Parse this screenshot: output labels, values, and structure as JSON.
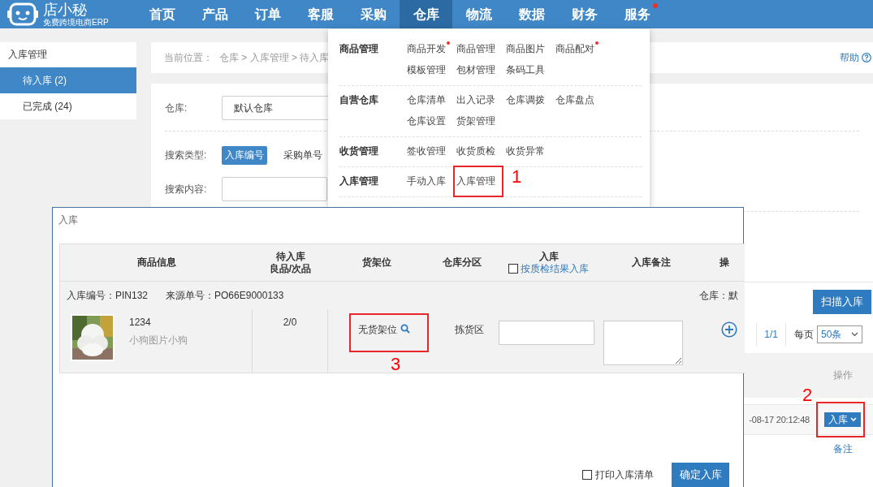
{
  "logo": {
    "name": "店小秘",
    "tagline": "免费跨境电商ERP"
  },
  "nav": [
    {
      "label": "首页",
      "selected": false,
      "dot": false
    },
    {
      "label": "产品",
      "selected": false,
      "dot": false
    },
    {
      "label": "订单",
      "selected": false,
      "dot": false
    },
    {
      "label": "客服",
      "selected": false,
      "dot": false
    },
    {
      "label": "采购",
      "selected": false,
      "dot": false
    },
    {
      "label": "仓库",
      "selected": true,
      "dot": false
    },
    {
      "label": "物流",
      "selected": false,
      "dot": false
    },
    {
      "label": "数据",
      "selected": false,
      "dot": false
    },
    {
      "label": "财务",
      "selected": false,
      "dot": false
    },
    {
      "label": "服务",
      "selected": false,
      "dot": true
    }
  ],
  "menu": {
    "groups": [
      {
        "title": "商品管理",
        "items": [
          {
            "label": "商品开发",
            "dot": true
          },
          {
            "label": "商品管理",
            "dot": false
          },
          {
            "label": "商品图片",
            "dot": false
          },
          {
            "label": "商品配对",
            "dot": true
          },
          {
            "label": "模板管理",
            "dot": false
          },
          {
            "label": "包材管理",
            "dot": false
          },
          {
            "label": "条码工具",
            "dot": false
          }
        ]
      },
      {
        "title": "自营仓库",
        "items": [
          {
            "label": "仓库清单",
            "dot": false
          },
          {
            "label": "出入记录",
            "dot": false
          },
          {
            "label": "仓库调拨",
            "dot": false
          },
          {
            "label": "仓库盘点",
            "dot": false
          },
          {
            "label": "仓库设置",
            "dot": false
          },
          {
            "label": "货架管理",
            "dot": false
          }
        ]
      },
      {
        "title": "收货管理",
        "items": [
          {
            "label": "签收管理",
            "dot": false
          },
          {
            "label": "收货质检",
            "dot": false
          },
          {
            "label": "收货异常",
            "dot": false
          }
        ]
      },
      {
        "title": "入库管理",
        "items": [
          {
            "label": "手动入库",
            "dot": false
          },
          {
            "label": "入库管理",
            "dot": false,
            "marker": "1"
          }
        ]
      }
    ]
  },
  "sidebar": {
    "title": "入库管理",
    "items": [
      {
        "label": "待入库 (2)",
        "selected": true
      },
      {
        "label": "已完成 (24)",
        "selected": false
      }
    ]
  },
  "breadcrumb": {
    "prefix": "当前位置：",
    "path": "仓库 > 入库管理 > 待入库"
  },
  "help": "帮助",
  "filters": {
    "warehouse_label": "仓库:",
    "warehouse_value": "默认仓库",
    "search_type_label": "搜索类型:",
    "search_types": [
      {
        "label": "入库编号",
        "selected": true
      },
      {
        "label": "采购单号",
        "selected": false
      }
    ],
    "search_content_label": "搜索内容:"
  },
  "list": {
    "scan_button": "扫描入库",
    "page": "1/1",
    "per_page_label": "每页",
    "per_page": "50条",
    "columns": [
      "操作"
    ],
    "rows": [
      {
        "time": "-08-17 20:12:48",
        "action": "入库",
        "marker": "2",
        "note": "备注"
      }
    ]
  },
  "modal": {
    "title": "入库",
    "columns": [
      {
        "label": "商品信息"
      },
      {
        "label": "待入库",
        "sublabel": "良品/次品"
      },
      {
        "label": "货架位"
      },
      {
        "label": "仓库分区"
      },
      {
        "label": "入库",
        "checkbox": {
          "label": "按质检结果入库",
          "checked": false
        }
      },
      {
        "label": "入库备注"
      },
      {
        "label": "操"
      }
    ],
    "group": {
      "inbound_no": "入库编号：PIN132",
      "source_no": "来源单号：PO66E9000133",
      "warehouse": "仓库：默"
    },
    "items": [
      {
        "sku": "1234",
        "name": "小狗图片小狗",
        "qty": "2/0",
        "shelf": "无货架位",
        "shelf_marker": "3",
        "zone": "拣货区"
      }
    ],
    "footer": {
      "print": {
        "label": "打印入库清单",
        "checked": false
      },
      "confirm": "确定入库"
    }
  }
}
